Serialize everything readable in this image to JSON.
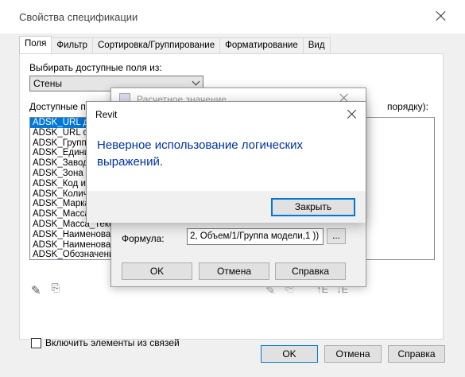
{
  "window": {
    "title": "Свойства спецификации"
  },
  "tabs": [
    "Поля",
    "Фильтр",
    "Сортировка/Группирование",
    "Форматирование",
    "Вид"
  ],
  "fields_panel": {
    "select_from_label": "Выбирать доступные поля из:",
    "category_value": "Стены",
    "available_label_partial": "Доступные по",
    "scheduled_label_partial": "порядку):",
    "available_items": [
      "ADSK_URL до",
      "ADSK_URL стр",
      "ADSK_Группи",
      "ADSK_Единиц",
      "ADSK_Завод-",
      "ADSK_Зона",
      "ADSK_Код из",
      "ADSK_Количе",
      "ADSK_Марка",
      "ADSK_Масса",
      "ADSK_Масса_Текст",
      "ADSK_Наименовани",
      "ADSK_Наименовани",
      "ADSK_Обозначение"
    ],
    "include_links_label": "Включить элементы из связей"
  },
  "main_buttons": {
    "ok": "OK",
    "cancel": "Отмена",
    "help": "Справка"
  },
  "calc_dialog": {
    "title": "Расчетное значение",
    "formula_label": "Формула:",
    "formula_value": "2, Объем/1/Группа модели,1 ))",
    "browse_label": "...",
    "ok": "OK",
    "cancel": "Отмена",
    "help": "Справка"
  },
  "message_box": {
    "title": "Revit",
    "message": "Неверное использование логических выражений.",
    "close_label": "Закрыть"
  },
  "icons": [
    "pencil-icon",
    "new-param-icon",
    "move-up-icon",
    "move-down-icon"
  ],
  "colors": {
    "selection": "#0078d7",
    "message_text": "#0033a0"
  }
}
